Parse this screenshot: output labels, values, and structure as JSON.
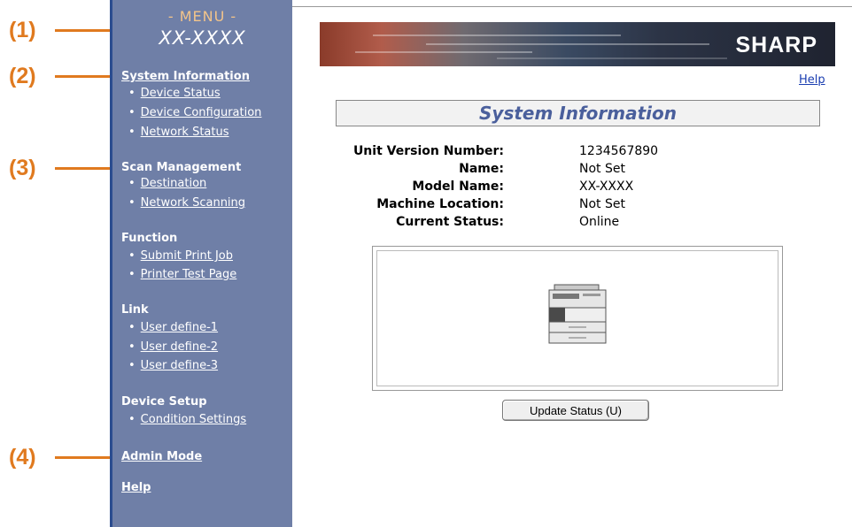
{
  "callouts": [
    "(1)",
    "(2)",
    "(3)",
    "(4)"
  ],
  "sidebar": {
    "menu_title": "- MENU -",
    "model": "XX-XXXX",
    "sections": {
      "system_information": "System Information",
      "scan_management": "Scan Management",
      "function": "Function",
      "link": "Link",
      "device_setup": "Device Setup",
      "admin_mode": "Admin Mode",
      "help": "Help"
    },
    "items": {
      "device_status": "Device Status",
      "device_configuration": "Device Configuration",
      "network_status": "Network Status",
      "destination": "Destination",
      "network_scanning": "Network Scanning",
      "submit_print_job": "Submit Print Job",
      "printer_test_page": "Printer Test Page",
      "user_define_1": "User define-1",
      "user_define_2": "User define-2",
      "user_define_3": "User define-3",
      "condition_settings": "Condition Settings"
    },
    "bullet": "•"
  },
  "banner": {
    "logo": "SHARP"
  },
  "main": {
    "help_link": "Help",
    "title": "System Information",
    "info": [
      {
        "label": "Unit Version Number:",
        "value": "1234567890"
      },
      {
        "label": "Name:",
        "value": "Not Set"
      },
      {
        "label": "Model Name:",
        "value": "XX-XXXX"
      },
      {
        "label": "Machine Location:",
        "value": "Not Set"
      },
      {
        "label": "Current Status:",
        "value": "Online"
      }
    ],
    "update_button": "Update Status (U)"
  },
  "colors": {
    "accent": "#e07a1f",
    "sidebar": "#6f7fa7",
    "title": "#4a5f9c",
    "link": "#1a3db0"
  },
  "icons": {
    "device": "printer-copier-icon"
  }
}
